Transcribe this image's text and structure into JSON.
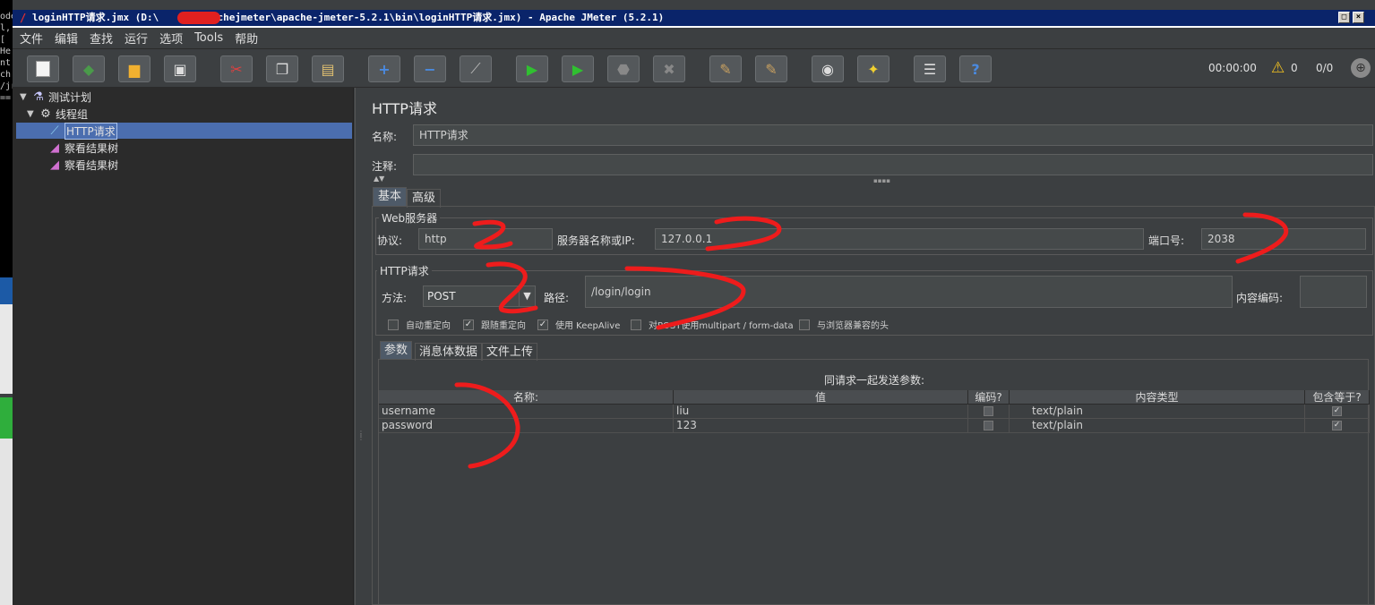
{
  "window": {
    "title_prefix": "loginHTTP请求.jmx (D:\\",
    "title_suffix": "pachejmeter\\apache-jmeter-5.2.1\\bin\\loginHTTP请求.jmx) - Apache JMeter (5.2.1)"
  },
  "console": {
    "lines": [
      "ode",
      "l,",
      " [",
      "He",
      "nt",
      "ch",
      "/jr",
      "=="
    ]
  },
  "menu": {
    "items": [
      "文件",
      "编辑",
      "查找",
      "运行",
      "选项",
      "Tools",
      "帮助"
    ]
  },
  "toolbar": {
    "timer": "00:00:00",
    "warnings": "0",
    "threads": "0/0"
  },
  "tree": {
    "test_plan": "测试计划",
    "thread_group": "线程组",
    "http_request": "HTTP请求",
    "listener_1": "察看结果树",
    "listener_2": "察看结果树"
  },
  "panel": {
    "title": "HTTP请求",
    "name_label": "名称:",
    "name_value": "HTTP请求",
    "comment_label": "注释:",
    "comment_value": ""
  },
  "tabs": {
    "basic": "基本",
    "advanced": "高级"
  },
  "web_server": {
    "group_title": "Web服务器",
    "protocol_label": "协议:",
    "protocol_value": "http",
    "server_label": "服务器名称或IP:",
    "server_value": "127.0.0.1",
    "port_label": "端口号:",
    "port_value": "2038"
  },
  "http_request": {
    "group_title": "HTTP请求",
    "method_label": "方法:",
    "method_value": "POST",
    "path_label": "路径:",
    "path_value": "/login/login",
    "encoding_label": "内容编码:",
    "encoding_value": ""
  },
  "checkboxes": [
    {
      "label": "自动重定向",
      "checked": false
    },
    {
      "label": "跟随重定向",
      "checked": true
    },
    {
      "label": "使用 KeepAlive",
      "checked": true
    },
    {
      "label": "对POST使用multipart / form-data",
      "checked": false
    },
    {
      "label": "与浏览器兼容的头",
      "checked": false
    }
  ],
  "subtabs": {
    "params": "参数",
    "body": "消息体数据",
    "files": "文件上传"
  },
  "params": {
    "caption": "同请求一起发送参数:",
    "headers": [
      "名称:",
      "值",
      "编码?",
      "内容类型",
      "包含等于?"
    ],
    "rows": [
      {
        "name": "username",
        "value": "liu",
        "encode": false,
        "content_type": "text/plain",
        "include_equals": true
      },
      {
        "name": "password",
        "value": "123",
        "encode": false,
        "content_type": "text/plain",
        "include_equals": true
      }
    ]
  }
}
